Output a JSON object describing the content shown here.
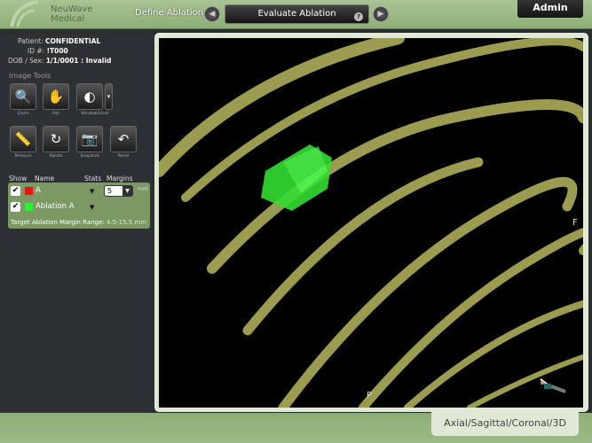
{
  "header": {
    "brand_line1": "NeuWave",
    "brand_line2": "Medical",
    "prev_step": "Define Ablation",
    "current_step": "Evaluate Ablation",
    "help": "?",
    "user": "Admin"
  },
  "patient": {
    "patient_label": "Patient:",
    "patient_value": "CONFIDENTIAL",
    "id_label": "ID #:",
    "id_value": "!T000",
    "dob_label": "DOB / Sex:",
    "dob_value": "1/1/0001 : Invalid"
  },
  "tools": {
    "title": "Image Tools",
    "items": [
      {
        "label": "Zoom",
        "icon": "magnifier-icon"
      },
      {
        "label": "Pan",
        "icon": "hand-icon"
      },
      {
        "label": "Window/Level",
        "icon": "contrast-icon"
      },
      {
        "label": "Measure",
        "icon": "ruler-icon"
      },
      {
        "label": "Rotate",
        "icon": "rotate-icon"
      },
      {
        "label": "Snapshot",
        "icon": "camera-icon"
      },
      {
        "label": "Reset",
        "icon": "undo-icon"
      }
    ]
  },
  "table": {
    "headers": {
      "show": "Show",
      "name": "Name",
      "stats": "Stats",
      "margins": "Margins"
    },
    "rows": [
      {
        "name": "A",
        "color": "#ee1111",
        "checked": true
      },
      {
        "name": "Ablation A",
        "color": "#33ee33",
        "checked": true
      }
    ],
    "margin_value": "5",
    "margin_unit": "mm",
    "range_label": "Target Ablation Margin Range:",
    "range_value": "4.5-15.5 mm"
  },
  "viewport": {
    "orient_right": "F",
    "orient_bottom": "P",
    "colors": {
      "bone": "#c8c870",
      "ablation": "#33ee33"
    }
  },
  "views_tab": "Axial/Sagittal/Coronal/3D"
}
